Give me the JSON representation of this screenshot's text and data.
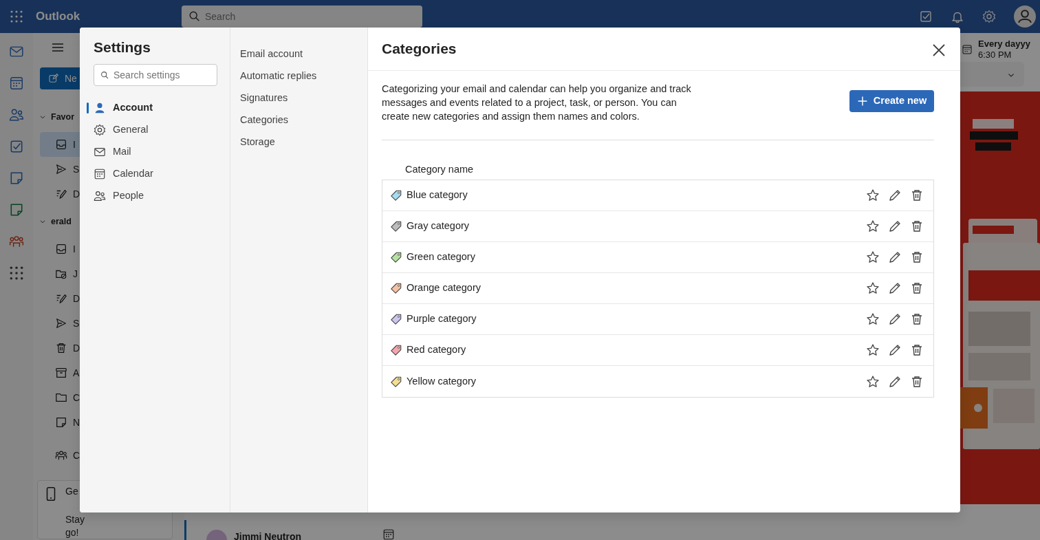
{
  "top_bar": {
    "app_name": "Outlook",
    "search": {
      "placeholder": "Search"
    }
  },
  "folder_pane": {
    "new_button": "Ne",
    "sections": [
      {
        "label": "Favor",
        "folders": [
          {
            "kind": "inbox",
            "label": "I",
            "selected": true
          },
          {
            "kind": "sent",
            "label": "S",
            "selected": false
          },
          {
            "kind": "drafts",
            "label": "D",
            "selected": false
          }
        ]
      },
      {
        "label": "erald",
        "folders": [
          {
            "kind": "inbox",
            "label": "I",
            "selected": false
          },
          {
            "kind": "junk",
            "label": "J",
            "selected": false
          },
          {
            "kind": "drafts",
            "label": "D",
            "selected": false
          },
          {
            "kind": "sent",
            "label": "S",
            "selected": false
          },
          {
            "kind": "deleted",
            "label": "D",
            "selected": false
          },
          {
            "kind": "archive",
            "label": "A",
            "selected": false
          },
          {
            "kind": "folder",
            "label": "C",
            "selected": false
          },
          {
            "kind": "notes",
            "label": "N",
            "selected": false
          },
          {
            "kind": "groups",
            "label": "C",
            "selected": false
          }
        ]
      }
    ]
  },
  "promo_card": {
    "lines": [
      "Ge",
      "Stay",
      "go!"
    ]
  },
  "message_list": {
    "sender": "Jimmi Neutron"
  },
  "reading_pane": {
    "event_title": "Every dayyy",
    "event_time": "6:30 PM"
  },
  "settings": {
    "title": "Settings",
    "search": {
      "placeholder": "Search settings"
    },
    "sections": [
      {
        "kind": "person",
        "label": "Account",
        "selected": true
      },
      {
        "kind": "gear",
        "label": "General",
        "selected": false
      },
      {
        "kind": "mail",
        "label": "Mail",
        "selected": false
      },
      {
        "kind": "calendar",
        "label": "Calendar",
        "selected": false
      },
      {
        "kind": "people",
        "label": "People",
        "selected": false
      }
    ],
    "subsections": [
      "Email account",
      "Automatic replies",
      "Signatures",
      "Categories",
      "Storage"
    ],
    "page": {
      "title": "Categories",
      "description": "Categorizing your email and calendar can help you organize and track messages and events related to a project, task, or person. You can create new categories and assign them names and colors.",
      "create_button": "Create new",
      "column": "Category name",
      "categories": [
        {
          "name": "Blue category",
          "color": "#a8dcef"
        },
        {
          "name": "Gray category",
          "color": "#bdbdbd"
        },
        {
          "name": "Green category",
          "color": "#b4e2a0"
        },
        {
          "name": "Orange category",
          "color": "#f5c3a3"
        },
        {
          "name": "Purple category",
          "color": "#cfc5f2"
        },
        {
          "name": "Red category",
          "color": "#f3a6ac"
        },
        {
          "name": "Yellow category",
          "color": "#f3de93"
        }
      ]
    }
  }
}
